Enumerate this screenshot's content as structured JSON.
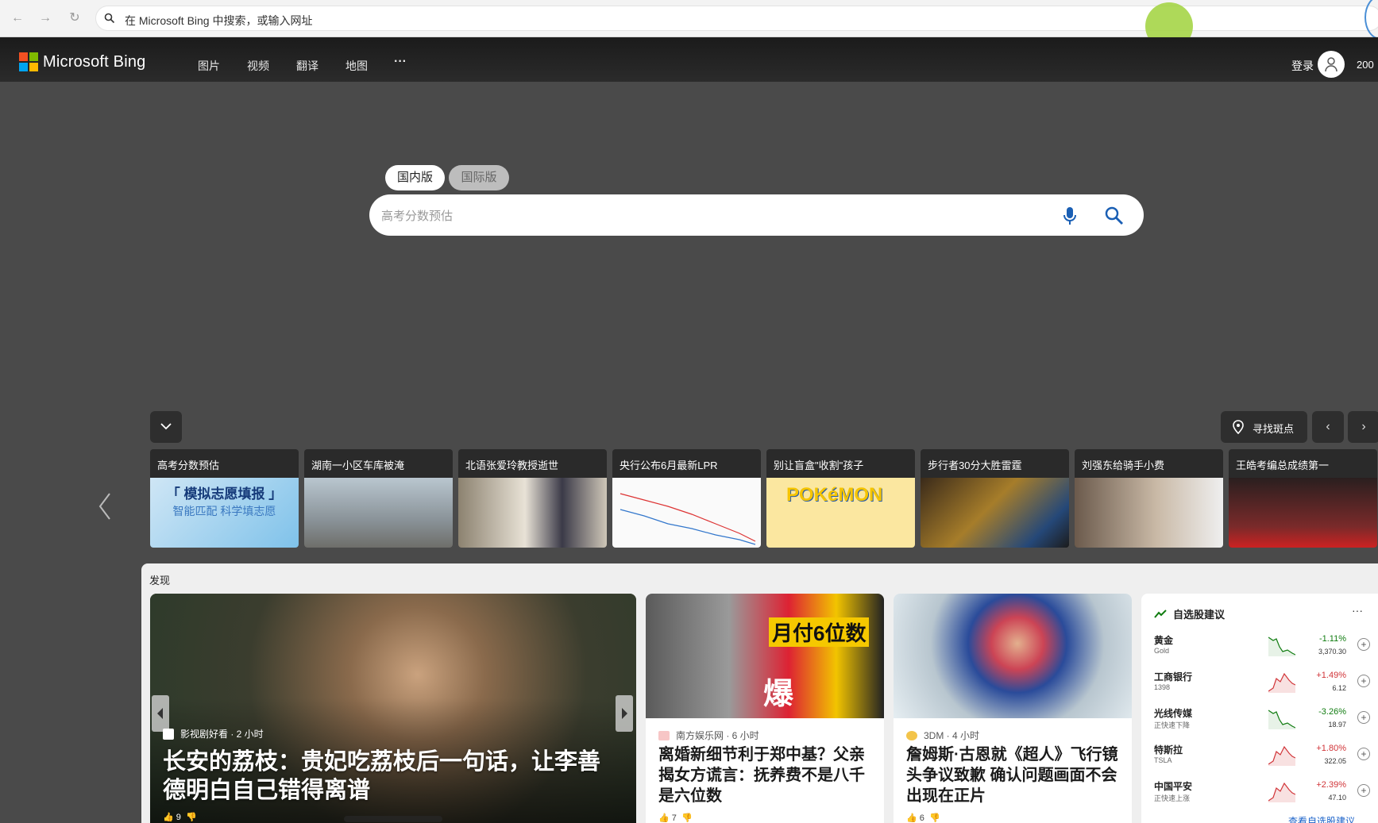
{
  "browser": {
    "address_placeholder": "在 Microsoft Bing 中搜索，或输入网址",
    "back_icon": "arrow-left-icon",
    "forward_icon": "arrow-right-icon",
    "reload_icon": "reload-icon"
  },
  "header": {
    "brand": "Microsoft Bing",
    "nav": [
      "图片",
      "视频",
      "翻译",
      "地图"
    ],
    "more": "···",
    "login": "登录",
    "points": "200"
  },
  "search": {
    "tab_domestic": "国内版",
    "tab_international": "国际版",
    "placeholder": "高考分数预估"
  },
  "trending": {
    "find_label": "寻找斑点",
    "items": [
      {
        "title": "高考分数预估",
        "img_text": "「 模拟志愿填报 」",
        "img_sub": "智能匹配 科学填志愿"
      },
      {
        "title": "湖南一小区车库被淹"
      },
      {
        "title": "北语张爱玲教授逝世"
      },
      {
        "title": "央行公布6月最新LPR"
      },
      {
        "title": "别让盲盒\"收割\"孩子",
        "img_text": "POKéMON"
      },
      {
        "title": "步行者30分大胜雷霆"
      },
      {
        "title": "刘强东给骑手小费"
      },
      {
        "title": "王皓考编总成绩第一"
      }
    ]
  },
  "discover": {
    "title": "发现",
    "hero": {
      "source": "影视剧好看 · 2 小时",
      "headline": "长安的荔枝：贵妃吃荔枝后一句话，让李善德明白自己错得离谱",
      "likes": "9"
    },
    "cards": [
      {
        "source": "南方娱乐网 · 6 小时",
        "headline": "离婚新细节利于郑中基？父亲揭女方谎言：抚养费不是八千是六位数",
        "likes": "7",
        "img_text": "月付6位数",
        "img_badge": "爆"
      },
      {
        "source": "3DM · 4 小时",
        "headline": "詹姆斯·古恩就《超人》飞行镜头争议致歉 确认问题画面不会出现在正片",
        "likes": "6"
      }
    ]
  },
  "stocks": {
    "title": "自选股建议",
    "more": "···",
    "link": "查看自选股建议",
    "rows": [
      {
        "name": "黄金",
        "ticker": "Gold",
        "change": "-1.11%",
        "price": "3,370.30",
        "trend": "down"
      },
      {
        "name": "工商银行",
        "ticker": "1398",
        "change": "+1.49%",
        "price": "6.12",
        "trend": "up"
      },
      {
        "name": "光线传媒",
        "ticker": "正快速下降",
        "change": "-3.26%",
        "price": "18.97",
        "trend": "down"
      },
      {
        "name": "特斯拉",
        "ticker": "TSLA",
        "change": "+1.80%",
        "price": "322.05",
        "trend": "up"
      },
      {
        "name": "中国平安",
        "ticker": "正快速上涨",
        "change": "+2.39%",
        "price": "47.10",
        "trend": "up"
      }
    ],
    "colors": {
      "up": "#d13438",
      "down": "#107c10"
    }
  }
}
